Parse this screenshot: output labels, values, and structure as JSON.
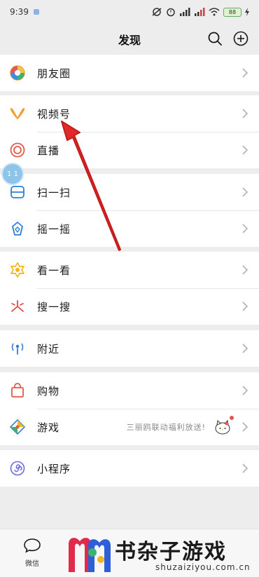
{
  "status_bar": {
    "time": "9:39",
    "battery": "88"
  },
  "header": {
    "title": "发现"
  },
  "menu": {
    "moments": "朋友圈",
    "channels": "视频号",
    "live": "直播",
    "scan": "扫一扫",
    "shake": "摇一摇",
    "top_stories": "看一看",
    "search": "搜一搜",
    "nearby": "附近",
    "shopping": "购物",
    "games": "游戏",
    "games_promo": "三丽鸥联动福利放送!",
    "mini_programs": "小程序"
  },
  "float_ball": {
    "text": "1 1"
  },
  "tabbar": {
    "chats": "微信"
  },
  "watermark": {
    "text": "书杂子游戏",
    "url": "shuzaiziyou.com.cn"
  },
  "colors": {
    "accent_red": "#e02a2a",
    "background": "#ededed"
  }
}
